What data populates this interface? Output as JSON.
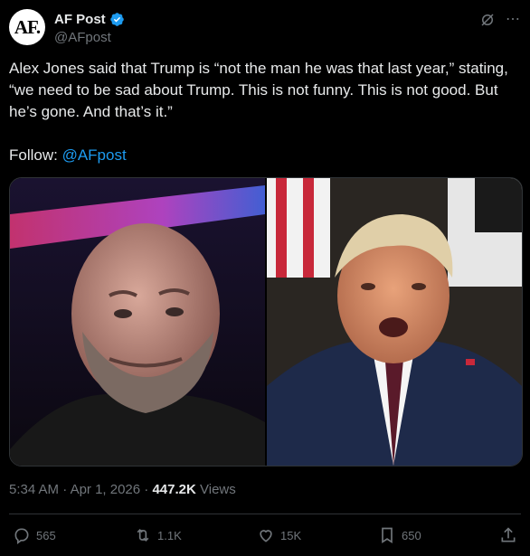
{
  "author": {
    "avatar_text": "AF.",
    "display_name": "AF Post",
    "handle": "@AFpost"
  },
  "tweet": {
    "text_main": "Alex Jones said that Trump is “not the man he was that last year,” stating, “we need to be sad about Trump. This is not funny. This is not good. But he’s gone. And that’s it.”",
    "follow_prefix": "Follow: ",
    "follow_handle": "@AFpost"
  },
  "media": {
    "left_photo": "photo-alex-jones",
    "right_photo": "photo-donald-trump"
  },
  "meta": {
    "time": "5:34 AM",
    "separator": "·",
    "date": "Apr 1, 2026",
    "views_count": "447.2K",
    "views_label": "Views"
  },
  "actions": {
    "replies": "565",
    "reposts": "1.1K",
    "likes": "15K",
    "bookmarks": "650"
  },
  "icons": [
    "verified-icon",
    "grok-icon",
    "more-icon",
    "reply-icon",
    "repost-icon",
    "like-icon",
    "bookmark-icon",
    "share-icon"
  ],
  "colors": {
    "accent": "#1d9bf0",
    "muted": "#71767b",
    "text": "#e7e9ea",
    "background": "#000000"
  }
}
